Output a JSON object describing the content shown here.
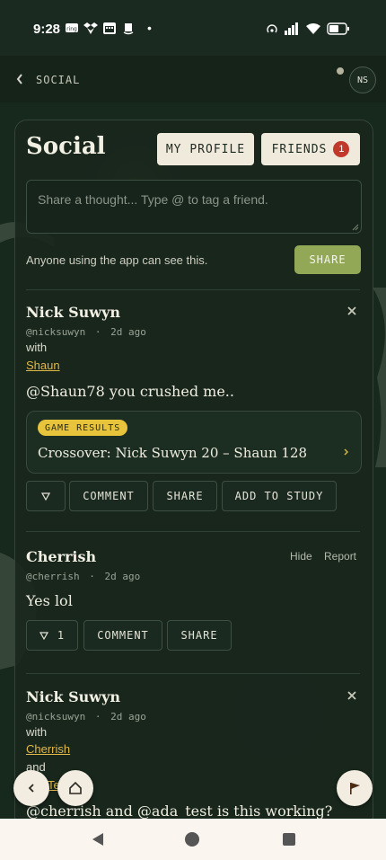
{
  "status_bar": {
    "time": "9:28",
    "dot": "•"
  },
  "header": {
    "breadcrumb": "SOCIAL",
    "avatar_initials": "NS"
  },
  "social": {
    "title": "Social",
    "my_profile_label": "MY PROFILE",
    "friends_label": "FRIENDS",
    "friends_count": "1",
    "composer_placeholder": "Share a thought... Type @ to tag a friend.",
    "visibility_note": "Anyone using the app can see this.",
    "share_label": "SHARE"
  },
  "posts": [
    {
      "author": "Nick Suwyn",
      "handle": "@nicksuwyn",
      "time": "2d ago",
      "with_label": "with",
      "tagged": "Shaun",
      "text": "@Shaun78 you crushed me..",
      "game_badge": "GAME RESULTS",
      "game_text": "Crossover: Nick Suwyn 20 – Shaun 128",
      "comment_label": "COMMENT",
      "share_label": "SHARE",
      "study_label": "ADD TO STUDY"
    },
    {
      "author": "Cherrish",
      "handle": "@cherrish",
      "time": "2d ago",
      "hide_label": "Hide",
      "report_label": "Report",
      "text": "Yes lol",
      "like_count": "1",
      "comment_label": "COMMENT",
      "share_label": "SHARE"
    },
    {
      "author": "Nick Suwyn",
      "handle": "@nicksuwyn",
      "time": "2d ago",
      "with_label": "with",
      "tagged": "Cherrish",
      "and_label": "and",
      "tagged2_partial": "Te",
      "text": "@cherrish and @ada_test is this working?"
    }
  ],
  "separator": "·",
  "colors": {
    "accent_green": "#92a857",
    "badge_red": "#c0392b",
    "link_gold": "#e0b84a",
    "cream": "#efeadc"
  }
}
